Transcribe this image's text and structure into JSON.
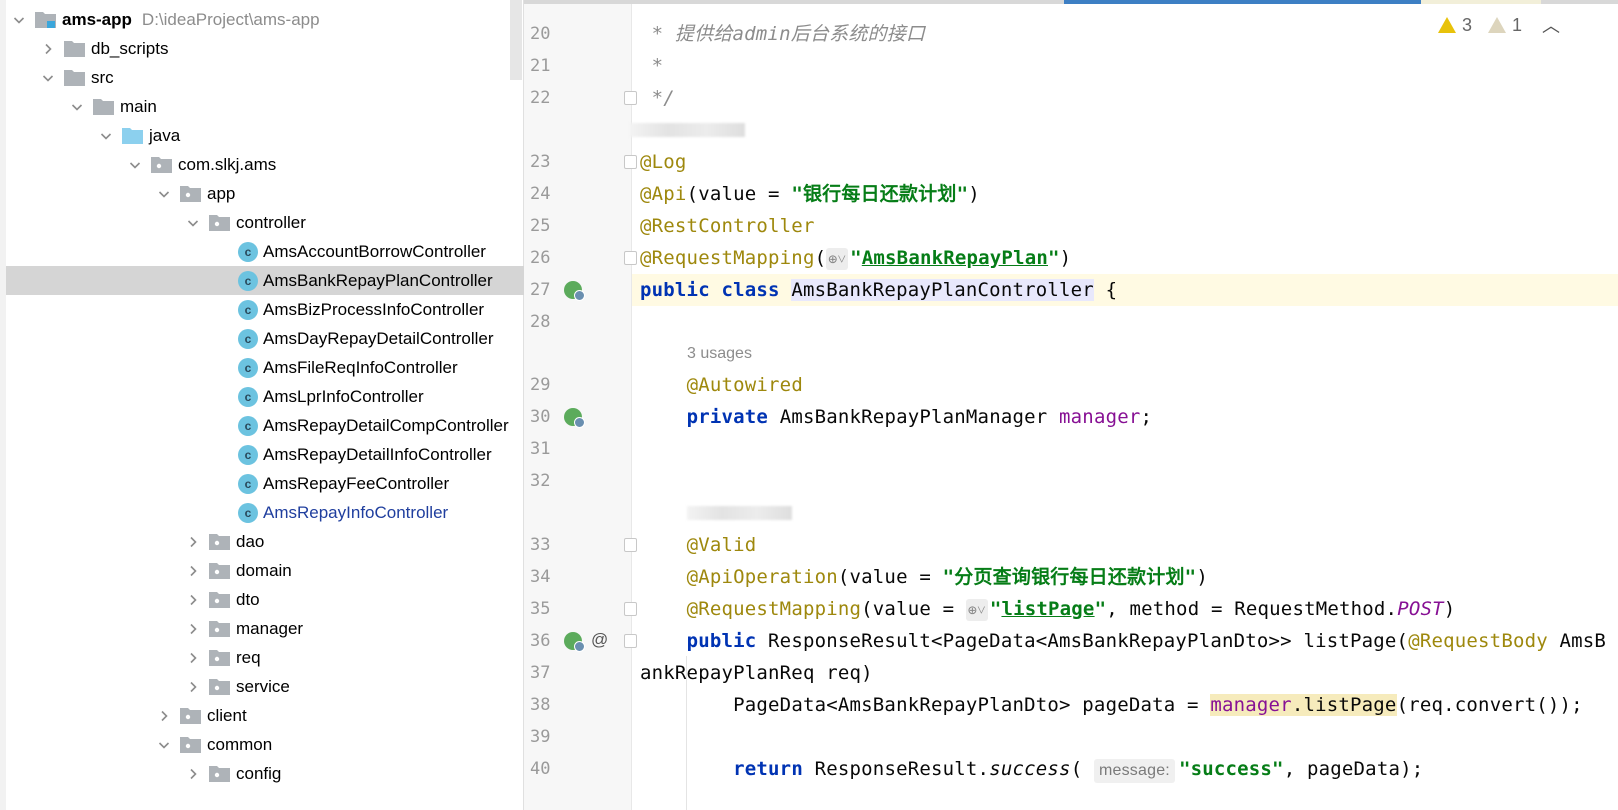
{
  "project_tree": {
    "rows": [
      {
        "label": "ams-app",
        "path": "D:\\ideaProject\\ams-app",
        "level": 0,
        "kind": "module",
        "expanded": true,
        "bold": true
      },
      {
        "label": "db_scripts",
        "level": 1,
        "kind": "folder",
        "expanded": false
      },
      {
        "label": "src",
        "level": 1,
        "kind": "folder",
        "expanded": true
      },
      {
        "label": "main",
        "level": 2,
        "kind": "folder",
        "expanded": true
      },
      {
        "label": "java",
        "level": 3,
        "kind": "source-folder",
        "expanded": true
      },
      {
        "label": "com.slkj.ams",
        "level": 4,
        "kind": "package",
        "expanded": true
      },
      {
        "label": "app",
        "level": 5,
        "kind": "package",
        "expanded": true
      },
      {
        "label": "controller",
        "level": 6,
        "kind": "package",
        "expanded": true
      },
      {
        "label": "AmsAccountBorrowController",
        "level": 7,
        "kind": "class"
      },
      {
        "label": "AmsBankRepayPlanController",
        "level": 7,
        "kind": "class",
        "selected": true
      },
      {
        "label": "AmsBizProcessInfoController",
        "level": 7,
        "kind": "class"
      },
      {
        "label": "AmsDayRepayDetailController",
        "level": 7,
        "kind": "class"
      },
      {
        "label": "AmsFileReqInfoController",
        "level": 7,
        "kind": "class"
      },
      {
        "label": "AmsLprInfoController",
        "level": 7,
        "kind": "class"
      },
      {
        "label": "AmsRepayDetailCompController",
        "level": 7,
        "kind": "class"
      },
      {
        "label": "AmsRepayDetailInfoController",
        "level": 7,
        "kind": "class"
      },
      {
        "label": "AmsRepayFeeController",
        "level": 7,
        "kind": "class"
      },
      {
        "label": "AmsRepayInfoController",
        "level": 7,
        "kind": "class",
        "modified": true
      },
      {
        "label": "dao",
        "level": 6,
        "kind": "package",
        "expanded": false
      },
      {
        "label": "domain",
        "level": 6,
        "kind": "package",
        "expanded": false
      },
      {
        "label": "dto",
        "level": 6,
        "kind": "package",
        "expanded": false
      },
      {
        "label": "manager",
        "level": 6,
        "kind": "package",
        "expanded": false
      },
      {
        "label": "req",
        "level": 6,
        "kind": "package",
        "expanded": false
      },
      {
        "label": "service",
        "level": 6,
        "kind": "package",
        "expanded": false
      },
      {
        "label": "client",
        "level": 5,
        "kind": "package",
        "expanded": false
      },
      {
        "label": "common",
        "level": 5,
        "kind": "package",
        "expanded": true
      },
      {
        "label": "config",
        "level": 6,
        "kind": "package",
        "expanded": false
      }
    ]
  },
  "editor": {
    "inspections": {
      "warnings": "3",
      "weak_warnings": "1"
    },
    "lines": [
      {
        "n": "20",
        "tokens": [
          {
            "t": " * 提供给admin后台系统的接口",
            "c": "cm"
          }
        ]
      },
      {
        "n": "21",
        "tokens": [
          {
            "t": " *",
            "c": "cm"
          }
        ]
      },
      {
        "n": "22",
        "fold": true,
        "tokens": [
          {
            "t": " */",
            "c": "cm"
          }
        ]
      },
      {
        "blur": true,
        "w": 115
      },
      {
        "n": "23",
        "fold": true,
        "tokens": [
          {
            "t": "@Log",
            "c": "an"
          }
        ]
      },
      {
        "n": "24",
        "tokens": [
          {
            "t": "@Api",
            "c": "an"
          },
          {
            "t": "(value = "
          },
          {
            "t": "\"银行每日还款计划\"",
            "c": "str"
          },
          {
            "t": ")"
          }
        ]
      },
      {
        "n": "25",
        "tokens": [
          {
            "t": "@RestController",
            "c": "an"
          }
        ]
      },
      {
        "n": "26",
        "fold": true,
        "tokens": [
          {
            "t": "@RequestMapping",
            "c": "an"
          },
          {
            "t": "("
          },
          {
            "globe": true
          },
          {
            "t": "\"",
            "c": "str"
          },
          {
            "t": "AmsBankRepayPlan",
            "c": "url"
          },
          {
            "t": "\"",
            "c": "str"
          },
          {
            "t": ")"
          }
        ]
      },
      {
        "n": "27",
        "current": true,
        "gutter_icon": "spring-bean-icon",
        "tokens": [
          {
            "t": "public class ",
            "c": "kw"
          },
          {
            "t": "AmsBankRepayPlanController",
            "c": "selcls"
          },
          {
            "t": " {"
          }
        ]
      },
      {
        "n": "28",
        "tokens": []
      },
      {
        "hint": "3 usages"
      },
      {
        "n": "29",
        "tokens": [
          {
            "t": "    "
          },
          {
            "t": "@Autowired",
            "c": "an"
          }
        ]
      },
      {
        "n": "30",
        "gutter_icon": "spring-bean-icon",
        "tokens": [
          {
            "t": "    "
          },
          {
            "t": "private ",
            "c": "kw"
          },
          {
            "t": "AmsBankRepayPlanManager "
          },
          {
            "t": "manager",
            "c": "fld"
          },
          {
            "t": ";"
          }
        ]
      },
      {
        "n": "31",
        "tokens": []
      },
      {
        "n": "32",
        "tokens": []
      },
      {
        "blur": true,
        "w": 105,
        "indent": true
      },
      {
        "n": "33",
        "fold": true,
        "tokens": [
          {
            "t": "    "
          },
          {
            "t": "@Valid",
            "c": "an"
          }
        ]
      },
      {
        "n": "34",
        "tokens": [
          {
            "t": "    "
          },
          {
            "t": "@ApiOperation",
            "c": "an"
          },
          {
            "t": "(value = "
          },
          {
            "t": "\"分页查询银行每日还款计划\"",
            "c": "str"
          },
          {
            "t": ")"
          }
        ]
      },
      {
        "n": "35",
        "fold": true,
        "tokens": [
          {
            "t": "    "
          },
          {
            "t": "@RequestMapping",
            "c": "an"
          },
          {
            "t": "(value = "
          },
          {
            "globe": true
          },
          {
            "t": "\"",
            "c": "str"
          },
          {
            "t": "listPage",
            "c": "url"
          },
          {
            "t": "\"",
            "c": "str"
          },
          {
            "t": ", method = RequestMethod."
          },
          {
            "t": "POST",
            "c": "cst"
          },
          {
            "t": ")"
          }
        ]
      },
      {
        "n": "36",
        "fold": true,
        "gutter_icon": "spring-bean-icon",
        "at": "@",
        "tokens": [
          {
            "t": "    "
          },
          {
            "t": "public ",
            "c": "kw"
          },
          {
            "t": "ResponseResult<PageData<AmsBankRepayPlanDto>> listPage("
          },
          {
            "t": "@RequestBody",
            "c": "an"
          },
          {
            "t": " AmsBankRepayPlanReq req)"
          }
        ]
      },
      {
        "n": "37",
        "tokens": []
      },
      {
        "n": "38",
        "tokens": [
          {
            "t": "        PageData<AmsBankRepayPlanDto> pageData = "
          },
          {
            "t": "manager",
            "c": "fld hl"
          },
          {
            "t": ".listPage",
            "c": "hl"
          },
          {
            "t": "(req.convert());"
          }
        ]
      },
      {
        "n": "39",
        "tokens": []
      },
      {
        "n": "40",
        "tokens": [
          {
            "t": "        "
          },
          {
            "t": "return ",
            "c": "kw"
          },
          {
            "t": "ResponseResult."
          },
          {
            "t": "success",
            "c": "it"
          },
          {
            "t": "( "
          },
          {
            "chip": "message:"
          },
          {
            "t": "\"success\"",
            "c": "str"
          },
          {
            "t": ", pageData);"
          }
        ]
      }
    ]
  }
}
